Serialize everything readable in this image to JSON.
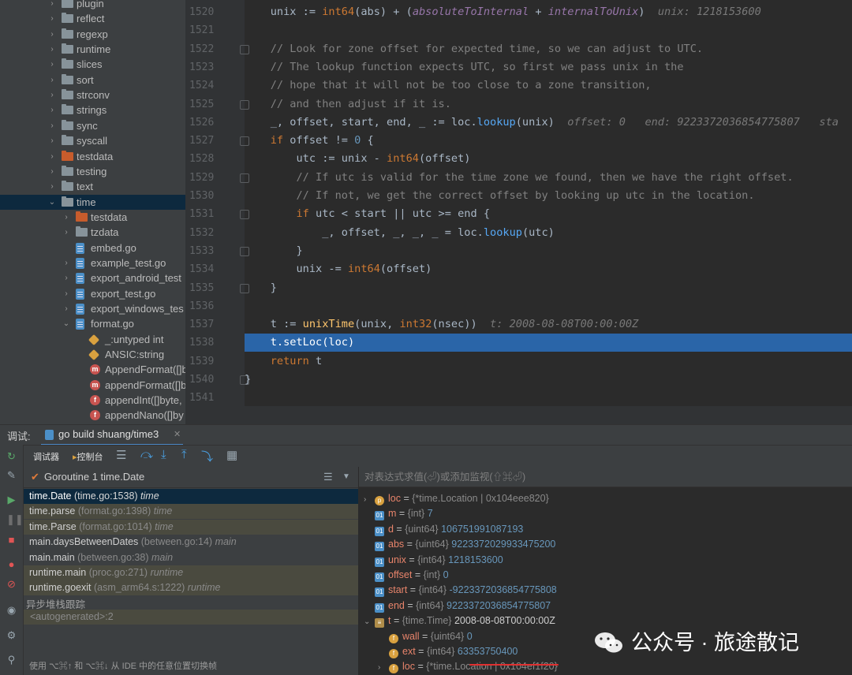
{
  "tree": [
    {
      "label": "plugin",
      "kind": "folder",
      "indent": 0,
      "chev": "›"
    },
    {
      "label": "reflect",
      "kind": "folder",
      "indent": 0,
      "chev": "›"
    },
    {
      "label": "regexp",
      "kind": "folder",
      "indent": 0,
      "chev": "›"
    },
    {
      "label": "runtime",
      "kind": "folder",
      "indent": 0,
      "chev": "›"
    },
    {
      "label": "slices",
      "kind": "folder",
      "indent": 0,
      "chev": "›"
    },
    {
      "label": "sort",
      "kind": "folder",
      "indent": 0,
      "chev": "›"
    },
    {
      "label": "strconv",
      "kind": "folder",
      "indent": 0,
      "chev": "›"
    },
    {
      "label": "strings",
      "kind": "folder",
      "indent": 0,
      "chev": "›"
    },
    {
      "label": "sync",
      "kind": "folder",
      "indent": 0,
      "chev": "›"
    },
    {
      "label": "syscall",
      "kind": "folder",
      "indent": 0,
      "chev": "›"
    },
    {
      "label": "testdata",
      "kind": "folder-orange",
      "indent": 0,
      "chev": "›"
    },
    {
      "label": "testing",
      "kind": "folder",
      "indent": 0,
      "chev": "›"
    },
    {
      "label": "text",
      "kind": "folder",
      "indent": 0,
      "chev": "›"
    },
    {
      "label": "time",
      "kind": "folder",
      "indent": 0,
      "chev": "⌄",
      "selected": true
    },
    {
      "label": "testdata",
      "kind": "folder-orange",
      "indent": 1,
      "chev": "›"
    },
    {
      "label": "tzdata",
      "kind": "folder",
      "indent": 1,
      "chev": "›"
    },
    {
      "label": "embed.go",
      "kind": "go",
      "indent": 1,
      "chev": ""
    },
    {
      "label": "example_test.go",
      "kind": "go",
      "indent": 1,
      "chev": "›"
    },
    {
      "label": "export_android_test",
      "kind": "go",
      "indent": 1,
      "chev": "›"
    },
    {
      "label": "export_test.go",
      "kind": "go",
      "indent": 1,
      "chev": "›"
    },
    {
      "label": "export_windows_tes",
      "kind": "go",
      "indent": 1,
      "chev": "›"
    },
    {
      "label": "format.go",
      "kind": "go",
      "indent": 1,
      "chev": "⌄"
    },
    {
      "label": "_:untyped int",
      "kind": "const",
      "indent": 2,
      "chev": ""
    },
    {
      "label": "ANSIC:string",
      "kind": "const",
      "indent": 2,
      "chev": ""
    },
    {
      "label": "AppendFormat([]b",
      "kind": "method",
      "indent": 2,
      "chev": ""
    },
    {
      "label": "appendFormat([]b",
      "kind": "method",
      "indent": 2,
      "chev": ""
    },
    {
      "label": "appendInt([]byte,",
      "kind": "func",
      "indent": 2,
      "chev": ""
    },
    {
      "label": "appendNano([]by",
      "kind": "func",
      "indent": 2,
      "chev": ""
    }
  ],
  "editor": {
    "lines": [
      {
        "n": "1520",
        "html": "<span>    unix := </span><span class=\"kw\">int64</span><span>(abs) + (</span><span class=\"it\">absoluteToInternal</span><span> + </span><span class=\"it\">internalToUnix</span><span>)  </span><span class=\"hint\">unix: 1218153600</span>"
      },
      {
        "n": "1521",
        "html": ""
      },
      {
        "n": "1522",
        "html": "<span class=\"cm\">    // Look for zone offset for expected time, so we can adjust to UTC.</span>"
      },
      {
        "n": "1523",
        "html": "<span class=\"cm\">    // The lookup function expects UTC, so first we pass unix in the</span>"
      },
      {
        "n": "1524",
        "html": "<span class=\"cm\">    // hope that it will not be too close to a zone transition,</span>"
      },
      {
        "n": "1525",
        "html": "<span class=\"cm\">    // and then adjust if it is.</span>"
      },
      {
        "n": "1526",
        "html": "<span>    _, offset, start, end, _ := loc.</span><span class=\"fnblue\">lookup</span><span>(unix)  </span><span class=\"hint\">offset: 0   end: 9223372036854775807   sta</span>"
      },
      {
        "n": "1527",
        "html": "<span class=\"kw\">    if</span><span> offset != </span><span class=\"nm\">0</span><span> {</span>"
      },
      {
        "n": "1528",
        "html": "<span>        utc := unix - </span><span class=\"kw\">int64</span><span>(offset)</span>"
      },
      {
        "n": "1529",
        "html": "<span class=\"cm\">        // If utc is valid for the time zone we found, then we have the right offset.</span>"
      },
      {
        "n": "1530",
        "html": "<span class=\"cm\">        // If not, we get the correct offset by looking up utc in the location.</span>"
      },
      {
        "n": "1531",
        "html": "<span class=\"kw\">        if</span><span> utc &lt; start || utc &gt;= end {</span>"
      },
      {
        "n": "1532",
        "html": "<span>            _, offset, _, _, _ = loc.</span><span class=\"fnblue\">lookup</span><span>(utc)</span>"
      },
      {
        "n": "1533",
        "html": "<span>        }</span>"
      },
      {
        "n": "1534",
        "html": "<span>        unix -= </span><span class=\"kw\">int64</span><span>(offset)</span>"
      },
      {
        "n": "1535",
        "html": "<span>    }</span>"
      },
      {
        "n": "1536",
        "html": ""
      },
      {
        "n": "1537",
        "html": "<span>    t := </span><span class=\"fn\">unixTime</span><span>(unix, </span><span class=\"kw\">int32</span><span>(nsec))  </span><span class=\"hint\">t: 2008-08-08T00:00:00Z</span>"
      },
      {
        "n": "1538",
        "html": "<span>    t.</span><span>setLoc</span><span>(loc)</span>",
        "highlight": true
      },
      {
        "n": "1539",
        "html": "<span class=\"kw\">    return</span><span> t</span>"
      },
      {
        "n": "1540",
        "html": "<span>}</span>"
      },
      {
        "n": "1541",
        "html": ""
      }
    ]
  },
  "debug": {
    "label": "调试:",
    "run_tab": "go build shuang/time3",
    "tab_debugger": "调试器",
    "tab_console": "控制台",
    "thread": "Goroutine 1 time.Date",
    "eval_placeholder": "对表达式求值(⏎)或添加监视(⇧⌘⏎)",
    "async_label": "异步堆栈跟踪",
    "autogen": "<autogenerated>:2",
    "footer_hint": "使用 ⌥⌘↑ 和 ⌥⌘↓ 从 IDE 中的任意位置切换帧",
    "frames": [
      {
        "fn": "time.Date",
        "loc": "(time.go:1538)",
        "pkg": "time",
        "style": "sel"
      },
      {
        "fn": "time.parse",
        "loc": "(format.go:1398)",
        "pkg": "time",
        "style": "lib"
      },
      {
        "fn": "time.Parse",
        "loc": "(format.go:1014)",
        "pkg": "time",
        "style": "lib"
      },
      {
        "fn": "main.daysBetweenDates",
        "loc": "(between.go:14)",
        "pkg": "main",
        "style": ""
      },
      {
        "fn": "main.main",
        "loc": "(between.go:38)",
        "pkg": "main",
        "style": ""
      },
      {
        "fn": "runtime.main",
        "loc": "(proc.go:271)",
        "pkg": "runtime",
        "style": "lib"
      },
      {
        "fn": "runtime.goexit",
        "loc": "(asm_arm64.s:1222)",
        "pkg": "runtime",
        "style": "lib"
      }
    ],
    "vars": [
      {
        "chev": "›",
        "icon": "p",
        "name": "loc",
        "type": "{*time.Location | 0x104eee820}",
        "val": "",
        "valclass": "vtype",
        "indent": 0
      },
      {
        "chev": "",
        "icon": "01",
        "name": "m",
        "type": "{int}",
        "val": "7",
        "valclass": "vval",
        "indent": 0
      },
      {
        "chev": "",
        "icon": "01",
        "name": "d",
        "type": "{uint64}",
        "val": "106751991087193",
        "valclass": "vval",
        "indent": 0
      },
      {
        "chev": "",
        "icon": "01",
        "name": "abs",
        "type": "{uint64}",
        "val": "9223372029933475200",
        "valclass": "vval",
        "indent": 0
      },
      {
        "chev": "",
        "icon": "01",
        "name": "unix",
        "type": "{int64}",
        "val": "1218153600",
        "valclass": "vval",
        "indent": 0
      },
      {
        "chev": "",
        "icon": "01",
        "name": "offset",
        "type": "{int}",
        "val": "0",
        "valclass": "vval",
        "indent": 0
      },
      {
        "chev": "",
        "icon": "01",
        "name": "start",
        "type": "{int64}",
        "val": "-9223372036854775808",
        "valclass": "vval",
        "indent": 0
      },
      {
        "chev": "",
        "icon": "01",
        "name": "end",
        "type": "{int64}",
        "val": "9223372036854775807",
        "valclass": "vval",
        "indent": 0
      },
      {
        "chev": "⌄",
        "icon": "s",
        "name": "t",
        "type": "{time.Time}",
        "val": "2008-08-08T00:00:00Z",
        "valclass": "vvalw",
        "indent": 0
      },
      {
        "chev": "",
        "icon": "f",
        "name": "wall",
        "type": "{uint64}",
        "val": "0",
        "valclass": "vval",
        "indent": 1
      },
      {
        "chev": "",
        "icon": "f",
        "name": "ext",
        "type": "{int64}",
        "val": "63353750400",
        "valclass": "vval",
        "indent": 1
      },
      {
        "chev": "›",
        "icon": "f",
        "name": "loc",
        "type": "{*time.Location | 0x104ef1f20}",
        "val": "",
        "valclass": "vtype",
        "indent": 1
      }
    ]
  },
  "watermark": "公众号 · 旅途散记",
  "colors": {
    "selection": "#2a65a8",
    "accent_red": "#e03030"
  }
}
